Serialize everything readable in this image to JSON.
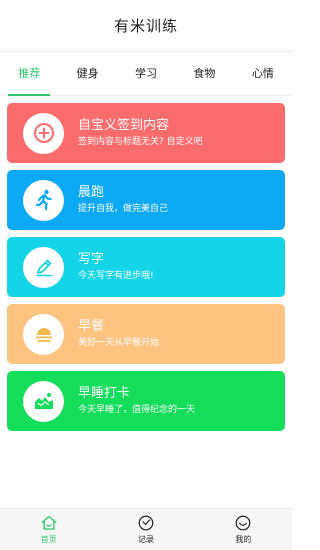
{
  "header": {
    "title": "有米训练"
  },
  "tabs": [
    {
      "label": "推荐",
      "active": true
    },
    {
      "label": "健身",
      "active": false
    },
    {
      "label": "学习",
      "active": false
    },
    {
      "label": "食物",
      "active": false
    },
    {
      "label": "心情",
      "active": false
    }
  ],
  "cards": [
    {
      "title": "自宝义签到内容",
      "subtitle": "签到内容与标题无关? 自定义吧",
      "color": "#fa6b6b",
      "icon": "plus-circle-icon"
    },
    {
      "title": "晨跑",
      "subtitle": "提升自我，做完美自己",
      "color": "#0ea9f5",
      "icon": "runner-icon"
    },
    {
      "title": "写字",
      "subtitle": "今天写字有进步哦!",
      "color": "#14d5e8",
      "icon": "pencil-icon"
    },
    {
      "title": "早餐",
      "subtitle": "美好一天从早餐开始",
      "color": "#fdc381",
      "icon": "sunrise-icon"
    },
    {
      "title": "早睡打卡",
      "subtitle": "今天早睡了，值得纪念的一天",
      "color": "#14dd59",
      "icon": "landscape-icon"
    }
  ],
  "bottom_nav": [
    {
      "label": "首页",
      "icon": "home-icon",
      "active": true
    },
    {
      "label": "记录",
      "icon": "clock-icon",
      "active": false
    },
    {
      "label": "我的",
      "icon": "smiley-icon",
      "active": false
    }
  ],
  "colors": {
    "accent": "#2ec56c"
  }
}
